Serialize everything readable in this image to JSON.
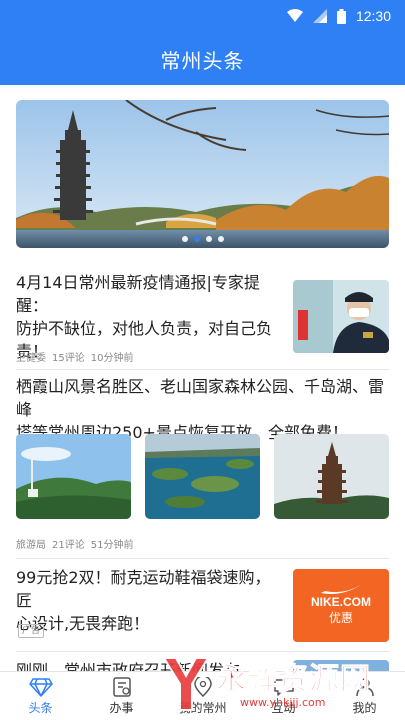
{
  "status_bar": {
    "time": "12:30",
    "icons": [
      "wifi-icon",
      "signal-icon",
      "battery-icon"
    ]
  },
  "header": {
    "title": "常州头条"
  },
  "banner": {
    "slide_count": 4,
    "active_index": 1
  },
  "feed": [
    {
      "title": "4月14日常州最新疫情通报|专家提醒：防护不缺位，对他人负责，对自己负责！",
      "title_line1": "4月14日常州最新疫情通报|专家提醒：",
      "title_line2": "防护不缺位，对他人负责，对自己负",
      "title_line3": "责！",
      "source": "卫健委",
      "comments": "15评论",
      "time": "10分钟前"
    },
    {
      "title_line1": "栖霞山风景名胜区、老山国家森林公园、千岛湖、雷峰",
      "title_line2": "塔等常州周边250+景点恢复开放，全部免费！",
      "source": "旅游局",
      "comments": "21评论",
      "time": "51分钟前"
    },
    {
      "title_line1": "99元抢2双！耐克运动鞋福袋速购，匠",
      "title_line2": "心设计,无畏奔跑！",
      "ad_label": "广告",
      "ad_image_text1": "NIKE.COM",
      "ad_image_text2": "优惠"
    },
    {
      "title_line1": "刚刚，常州市政府召开新闻发布"
    }
  ],
  "tab_bar": {
    "tabs": [
      {
        "label": "头条",
        "icon": "diamond-icon",
        "active": true
      },
      {
        "label": "办事",
        "icon": "document-icon",
        "active": false
      },
      {
        "label": "我的常州",
        "icon": "location-icon",
        "active": false
      },
      {
        "label": "互动",
        "icon": "chat-icon",
        "active": false
      },
      {
        "label": "我的",
        "icon": "user-icon",
        "active": false
      }
    ]
  },
  "watermark": {
    "text": "永辉资源网",
    "url": "www.yhkjjj.com"
  },
  "colors": {
    "primary": "#2f80f5",
    "ad_orange": "#f26522"
  }
}
